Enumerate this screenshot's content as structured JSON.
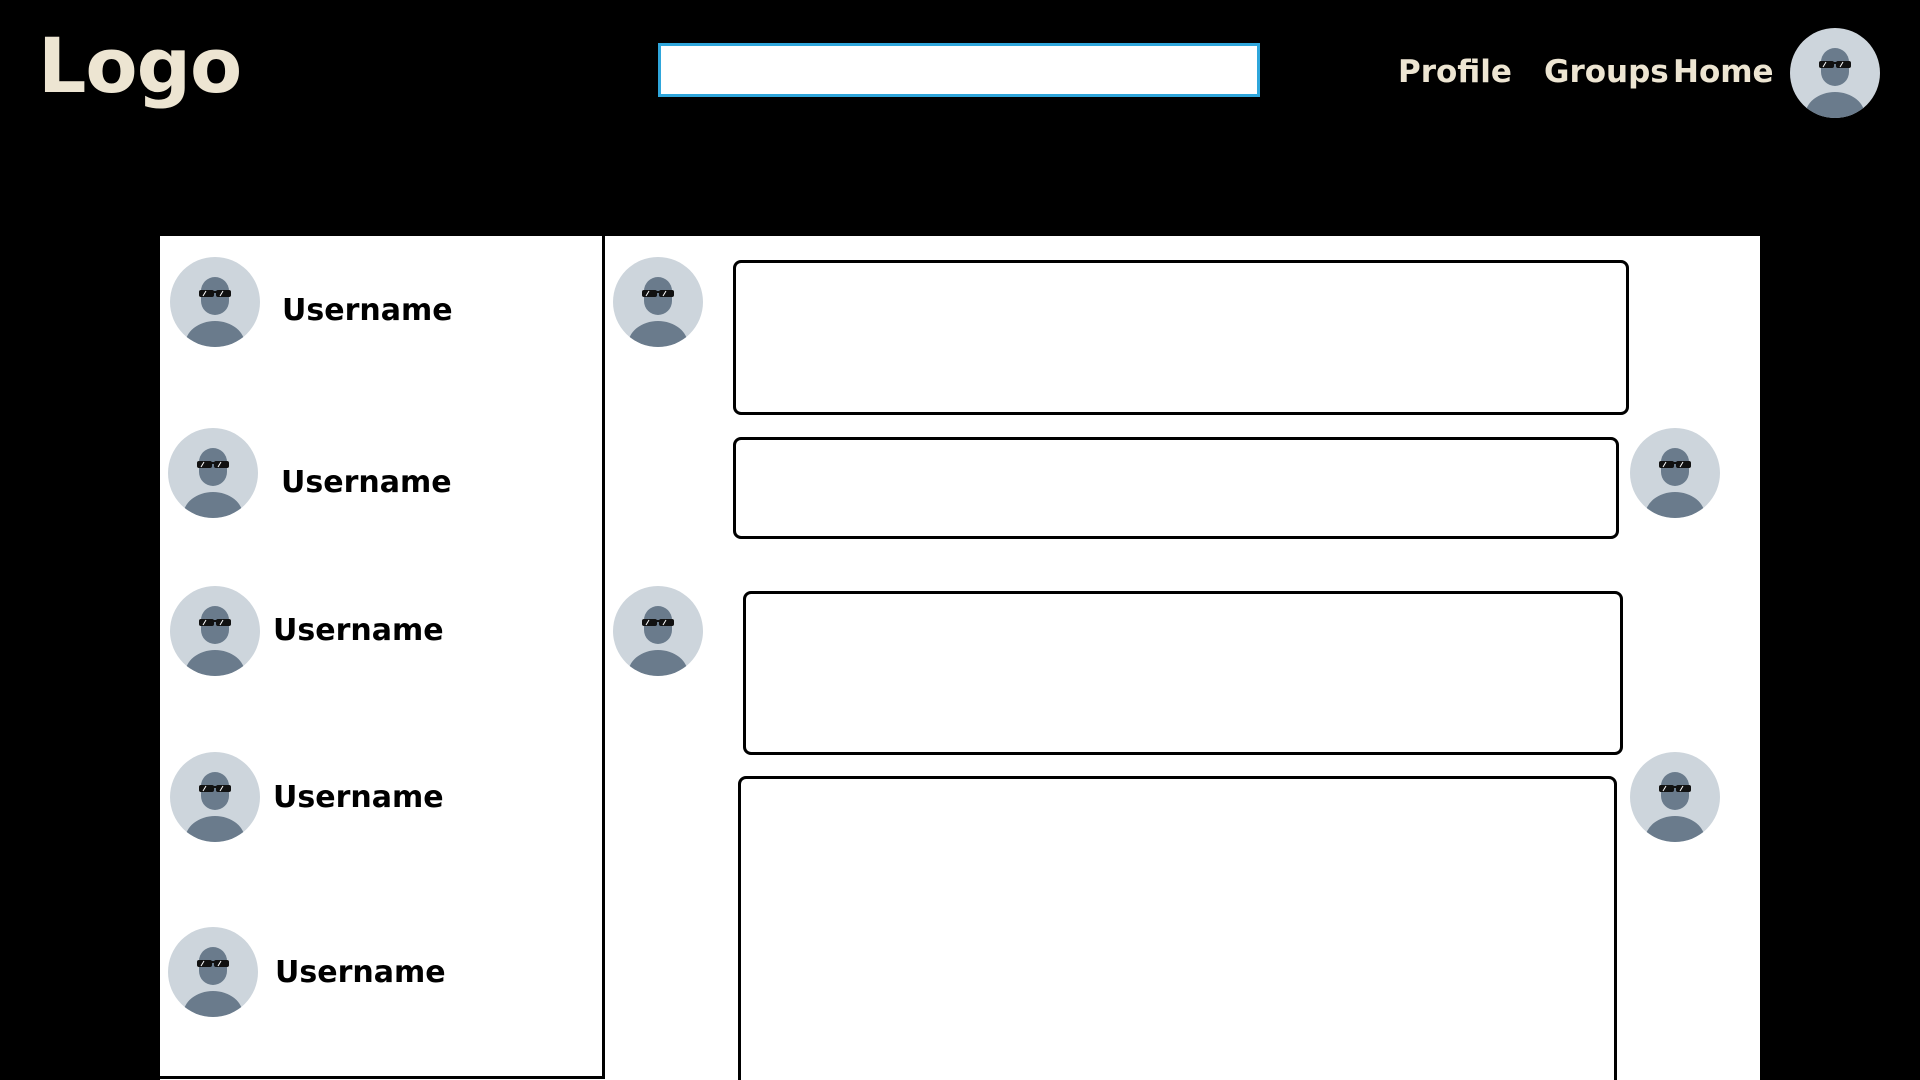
{
  "header": {
    "logo": "Logo",
    "search": {
      "value": "",
      "placeholder": ""
    },
    "nav": [
      {
        "label": "Profile"
      },
      {
        "label": "Groups"
      },
      {
        "label": "Home"
      }
    ],
    "avatar_icon": "user-avatar-sunglasses-icon"
  },
  "sidebar": {
    "users": [
      {
        "username": "Username"
      },
      {
        "username": "Username"
      },
      {
        "username": "Username"
      },
      {
        "username": "Username"
      },
      {
        "username": "Username"
      }
    ]
  },
  "chat": {
    "messages": [
      {
        "side": "left",
        "text": ""
      },
      {
        "side": "right",
        "text": ""
      },
      {
        "side": "left",
        "text": ""
      },
      {
        "side": "right",
        "text": ""
      }
    ]
  },
  "colors": {
    "background": "#000000",
    "header_text": "#EDE5D2",
    "search_border": "#2FA6DB",
    "avatar_bg": "#CDD5DC",
    "avatar_figure": "#6A7B8C"
  }
}
